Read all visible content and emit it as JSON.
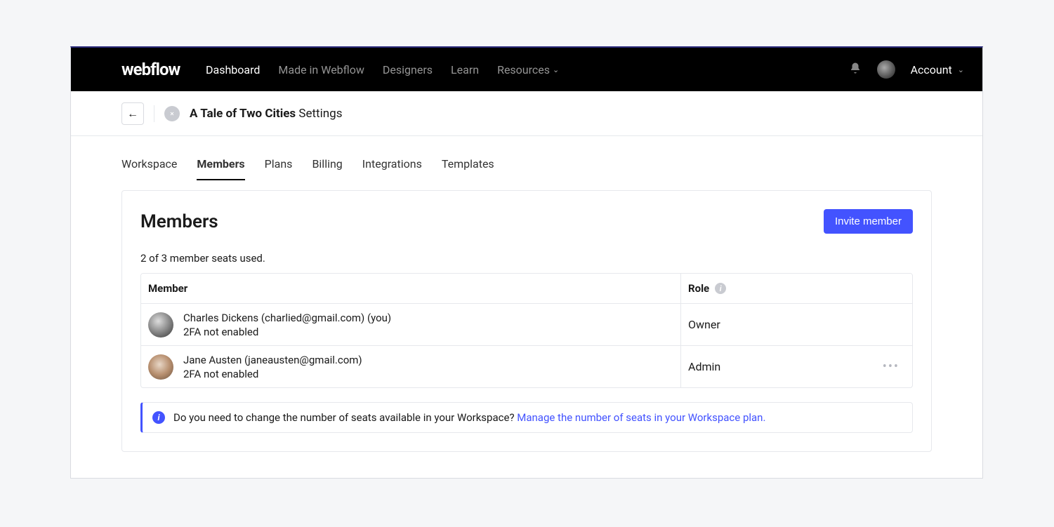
{
  "logo": "webflow",
  "nav": {
    "dashboard": "Dashboard",
    "madein": "Made in Webflow",
    "designers": "Designers",
    "learn": "Learn",
    "resources": "Resources",
    "account": "Account"
  },
  "crumb": {
    "workspace_name": "A Tale of Two Cities",
    "suffix": " Settings"
  },
  "tabs": {
    "workspace": "Workspace",
    "members": "Members",
    "plans": "Plans",
    "billing": "Billing",
    "integrations": "Integrations",
    "templates": "Templates"
  },
  "panel": {
    "title": "Members",
    "invite_label": "Invite member",
    "seats_text": "2 of 3 member seats used.",
    "col_member": "Member",
    "col_role": "Role"
  },
  "members": [
    {
      "line1": "Charles Dickens (charlied@gmail.com) (you)",
      "line2": "2FA not enabled",
      "role": "Owner",
      "has_actions": false
    },
    {
      "line1": "Jane Austen (janeausten@gmail.com)",
      "line2": "2FA not enabled",
      "role": "Admin",
      "has_actions": true
    }
  ],
  "info": {
    "text": "Do you need to change the number of seats available in your Workspace? ",
    "link": "Manage the number of seats in your Workspace plan."
  }
}
